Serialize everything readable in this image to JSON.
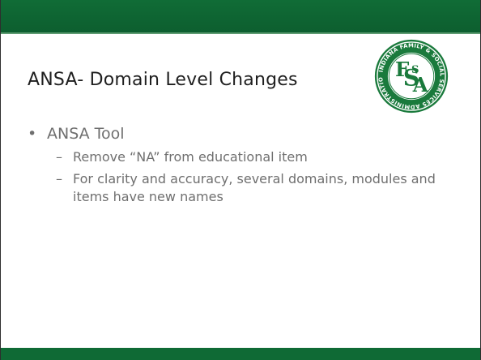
{
  "slide": {
    "title": "ANSA- Domain Level Changes",
    "bullets": [
      {
        "mark": "•",
        "text": "ANSA Tool",
        "sub_mark": "–",
        "subitems": [
          "Remove “NA” from educational item",
          "For clarity and accuracy, several domains, modules and items have new names"
        ]
      }
    ]
  },
  "logo": {
    "letters": "FSSA",
    "ring_text": "INDIANA FAMILY & SOCIAL SERVICES ADMINISTRATION",
    "color": "#1a7a3c"
  },
  "colors": {
    "band": "#0f6a35",
    "title": "#1f1f1f",
    "body": "#6f6f6f"
  }
}
